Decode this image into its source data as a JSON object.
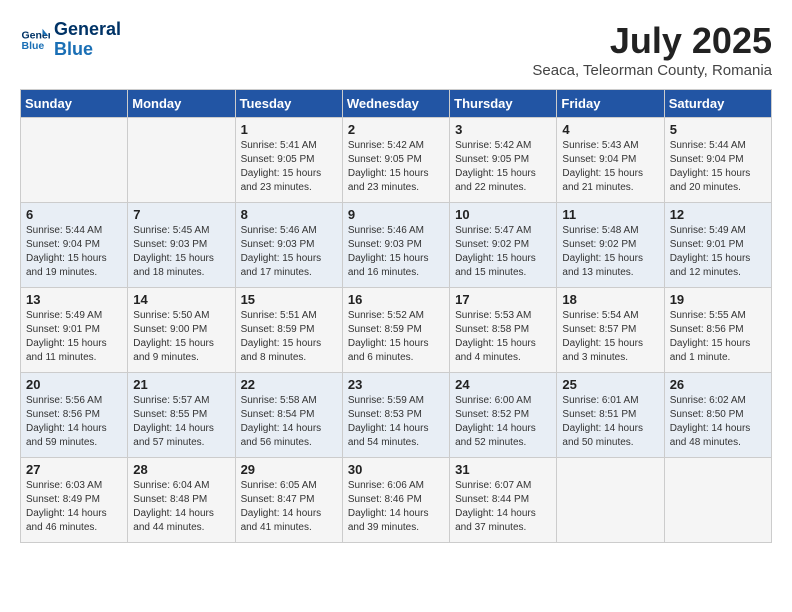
{
  "header": {
    "logo_line1": "General",
    "logo_line2": "Blue",
    "month_title": "July 2025",
    "subtitle": "Seaca, Teleorman County, Romania"
  },
  "weekdays": [
    "Sunday",
    "Monday",
    "Tuesday",
    "Wednesday",
    "Thursday",
    "Friday",
    "Saturday"
  ],
  "weeks": [
    [
      {
        "day": "",
        "info": ""
      },
      {
        "day": "",
        "info": ""
      },
      {
        "day": "1",
        "info": "Sunrise: 5:41 AM\nSunset: 9:05 PM\nDaylight: 15 hours\nand 23 minutes."
      },
      {
        "day": "2",
        "info": "Sunrise: 5:42 AM\nSunset: 9:05 PM\nDaylight: 15 hours\nand 23 minutes."
      },
      {
        "day": "3",
        "info": "Sunrise: 5:42 AM\nSunset: 9:05 PM\nDaylight: 15 hours\nand 22 minutes."
      },
      {
        "day": "4",
        "info": "Sunrise: 5:43 AM\nSunset: 9:04 PM\nDaylight: 15 hours\nand 21 minutes."
      },
      {
        "day": "5",
        "info": "Sunrise: 5:44 AM\nSunset: 9:04 PM\nDaylight: 15 hours\nand 20 minutes."
      }
    ],
    [
      {
        "day": "6",
        "info": "Sunrise: 5:44 AM\nSunset: 9:04 PM\nDaylight: 15 hours\nand 19 minutes."
      },
      {
        "day": "7",
        "info": "Sunrise: 5:45 AM\nSunset: 9:03 PM\nDaylight: 15 hours\nand 18 minutes."
      },
      {
        "day": "8",
        "info": "Sunrise: 5:46 AM\nSunset: 9:03 PM\nDaylight: 15 hours\nand 17 minutes."
      },
      {
        "day": "9",
        "info": "Sunrise: 5:46 AM\nSunset: 9:03 PM\nDaylight: 15 hours\nand 16 minutes."
      },
      {
        "day": "10",
        "info": "Sunrise: 5:47 AM\nSunset: 9:02 PM\nDaylight: 15 hours\nand 15 minutes."
      },
      {
        "day": "11",
        "info": "Sunrise: 5:48 AM\nSunset: 9:02 PM\nDaylight: 15 hours\nand 13 minutes."
      },
      {
        "day": "12",
        "info": "Sunrise: 5:49 AM\nSunset: 9:01 PM\nDaylight: 15 hours\nand 12 minutes."
      }
    ],
    [
      {
        "day": "13",
        "info": "Sunrise: 5:49 AM\nSunset: 9:01 PM\nDaylight: 15 hours\nand 11 minutes."
      },
      {
        "day": "14",
        "info": "Sunrise: 5:50 AM\nSunset: 9:00 PM\nDaylight: 15 hours\nand 9 minutes."
      },
      {
        "day": "15",
        "info": "Sunrise: 5:51 AM\nSunset: 8:59 PM\nDaylight: 15 hours\nand 8 minutes."
      },
      {
        "day": "16",
        "info": "Sunrise: 5:52 AM\nSunset: 8:59 PM\nDaylight: 15 hours\nand 6 minutes."
      },
      {
        "day": "17",
        "info": "Sunrise: 5:53 AM\nSunset: 8:58 PM\nDaylight: 15 hours\nand 4 minutes."
      },
      {
        "day": "18",
        "info": "Sunrise: 5:54 AM\nSunset: 8:57 PM\nDaylight: 15 hours\nand 3 minutes."
      },
      {
        "day": "19",
        "info": "Sunrise: 5:55 AM\nSunset: 8:56 PM\nDaylight: 15 hours\nand 1 minute."
      }
    ],
    [
      {
        "day": "20",
        "info": "Sunrise: 5:56 AM\nSunset: 8:56 PM\nDaylight: 14 hours\nand 59 minutes."
      },
      {
        "day": "21",
        "info": "Sunrise: 5:57 AM\nSunset: 8:55 PM\nDaylight: 14 hours\nand 57 minutes."
      },
      {
        "day": "22",
        "info": "Sunrise: 5:58 AM\nSunset: 8:54 PM\nDaylight: 14 hours\nand 56 minutes."
      },
      {
        "day": "23",
        "info": "Sunrise: 5:59 AM\nSunset: 8:53 PM\nDaylight: 14 hours\nand 54 minutes."
      },
      {
        "day": "24",
        "info": "Sunrise: 6:00 AM\nSunset: 8:52 PM\nDaylight: 14 hours\nand 52 minutes."
      },
      {
        "day": "25",
        "info": "Sunrise: 6:01 AM\nSunset: 8:51 PM\nDaylight: 14 hours\nand 50 minutes."
      },
      {
        "day": "26",
        "info": "Sunrise: 6:02 AM\nSunset: 8:50 PM\nDaylight: 14 hours\nand 48 minutes."
      }
    ],
    [
      {
        "day": "27",
        "info": "Sunrise: 6:03 AM\nSunset: 8:49 PM\nDaylight: 14 hours\nand 46 minutes."
      },
      {
        "day": "28",
        "info": "Sunrise: 6:04 AM\nSunset: 8:48 PM\nDaylight: 14 hours\nand 44 minutes."
      },
      {
        "day": "29",
        "info": "Sunrise: 6:05 AM\nSunset: 8:47 PM\nDaylight: 14 hours\nand 41 minutes."
      },
      {
        "day": "30",
        "info": "Sunrise: 6:06 AM\nSunset: 8:46 PM\nDaylight: 14 hours\nand 39 minutes."
      },
      {
        "day": "31",
        "info": "Sunrise: 6:07 AM\nSunset: 8:44 PM\nDaylight: 14 hours\nand 37 minutes."
      },
      {
        "day": "",
        "info": ""
      },
      {
        "day": "",
        "info": ""
      }
    ]
  ]
}
